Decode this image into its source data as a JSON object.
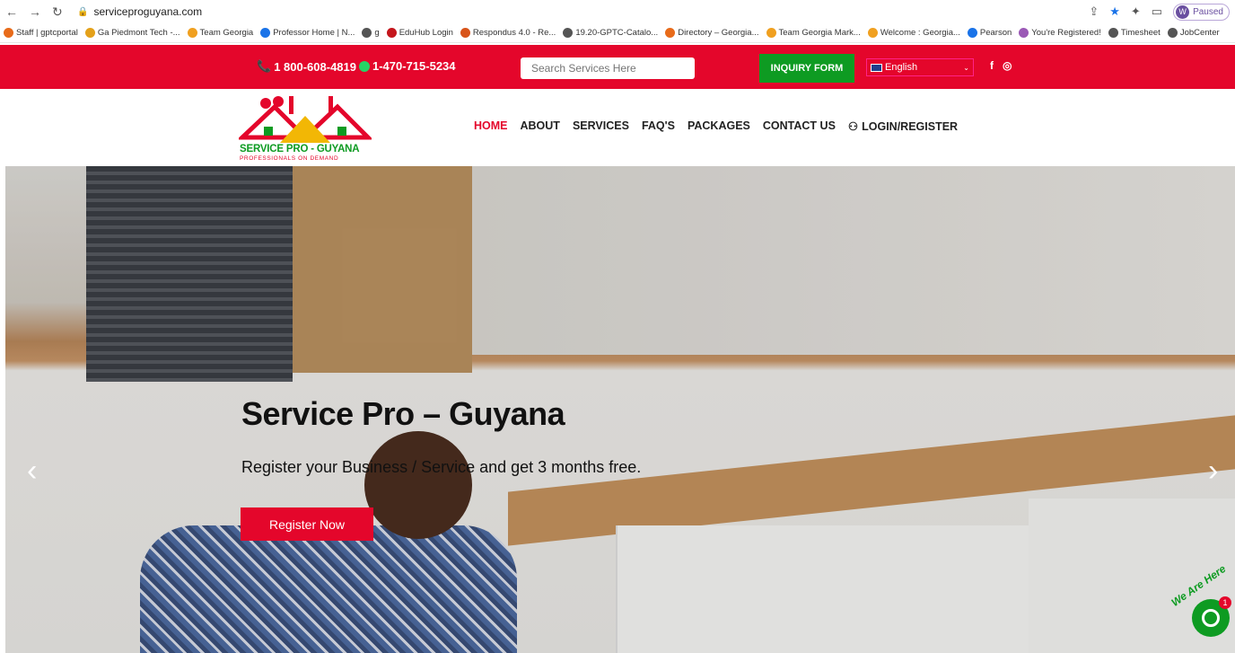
{
  "browser": {
    "url": "serviceproguyana.com",
    "profile_status": "Paused",
    "profile_initial": "W",
    "bookmarks": [
      {
        "label": "Staff | gptcportal",
        "color": "#e86b1a"
      },
      {
        "label": "Ga Piedmont Tech -...",
        "color": "#e4a11a"
      },
      {
        "label": "Team Georgia",
        "color": "#f0a020"
      },
      {
        "label": "Professor Home | N...",
        "color": "#1a73e8"
      },
      {
        "label": "g",
        "color": "#555555"
      },
      {
        "label": "EduHub Login",
        "color": "#c4161c"
      },
      {
        "label": "Respondus 4.0 - Re...",
        "color": "#d8541a"
      },
      {
        "label": "19.20-GPTC-Catalo...",
        "color": "#555555"
      },
      {
        "label": "Directory – Georgia...",
        "color": "#e86b1a"
      },
      {
        "label": "Team Georgia Mark...",
        "color": "#f0a020"
      },
      {
        "label": "Welcome : Georgia...",
        "color": "#f0a020"
      },
      {
        "label": "Pearson",
        "color": "#1a73e8"
      },
      {
        "label": "You're Registered!",
        "color": "#9b59b6"
      },
      {
        "label": "Timesheet",
        "color": "#555555"
      },
      {
        "label": "JobCenter",
        "color": "#555555"
      }
    ]
  },
  "topbar": {
    "phone1": "1 800-608-4819",
    "phone2": "1-470-715-5234",
    "search_placeholder": "Search Services Here",
    "inquiry_label": "INQUIRY FORM",
    "language": "English"
  },
  "logo": {
    "name": "SERVICE PRO - GUYANA",
    "tagline": "PROFESSIONALS ON DEMAND"
  },
  "nav": {
    "items": [
      "HOME",
      "ABOUT",
      "SERVICES",
      "FAQ'S",
      "PACKAGES",
      "CONTACT US"
    ],
    "login": "LOGIN/REGISTER"
  },
  "hero": {
    "title": "Service Pro – Guyana",
    "subtitle": "Register your Business / Service and get 3 months free.",
    "button": "Register Now"
  },
  "chat": {
    "badge": "1",
    "label": "We Are Here"
  },
  "colors": {
    "brand_red": "#e4062b",
    "brand_green": "#0e9b22"
  }
}
